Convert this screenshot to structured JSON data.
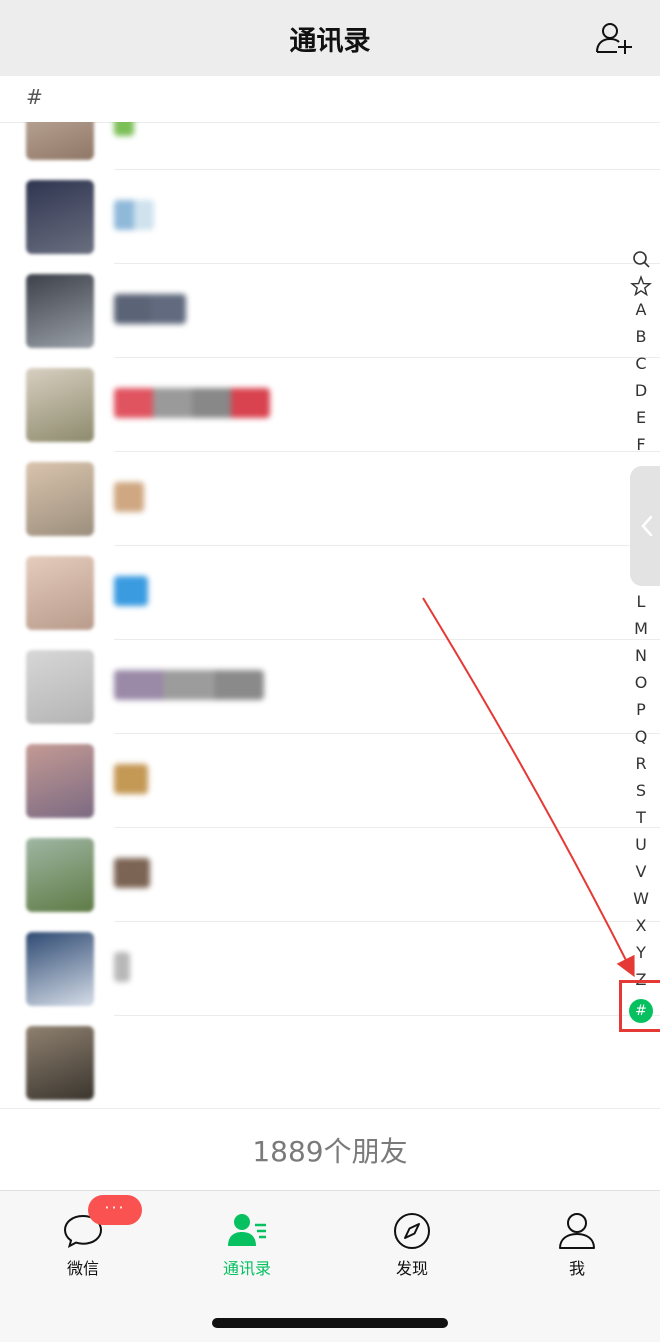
{
  "nav": {
    "title": "通讯录",
    "add_icon": "add-contact-icon"
  },
  "section": {
    "header": "#"
  },
  "contacts": [
    {
      "avatar_colors": [
        "#c9b5a7",
        "#8f7766"
      ],
      "name_colors": [
        "#7bbf57"
      ],
      "name_width": 20
    },
    {
      "avatar_colors": [
        "#2f3550",
        "#6a6f80"
      ],
      "name_colors": [
        "#8fb9d9",
        "#cfe2ee"
      ],
      "name_width": 40
    },
    {
      "avatar_colors": [
        "#3c4049",
        "#9aa0a8"
      ],
      "name_colors": [
        "#5b6377",
        "#616a7e"
      ],
      "name_width": 72
    },
    {
      "avatar_colors": [
        "#d8cfc1",
        "#8d8a6c"
      ],
      "name_colors": [
        "#e05460",
        "#9a9a9a",
        "#888",
        "#d8434f"
      ],
      "name_width": 156
    },
    {
      "avatar_colors": [
        "#d9c4ad",
        "#9c8e7d"
      ],
      "name_colors": [
        "#cfa882"
      ],
      "name_width": 30
    },
    {
      "avatar_colors": [
        "#e5ccbd",
        "#b89b8b"
      ],
      "name_colors": [
        "#3a9be0"
      ],
      "name_width": 34
    },
    {
      "avatar_colors": [
        "#d7d7d7",
        "#b4b4b4"
      ],
      "name_colors": [
        "#9a8aa8",
        "#9c9c9c",
        "#8a8a8a"
      ],
      "name_width": 150
    },
    {
      "avatar_colors": [
        "#c49a94",
        "#7b6a82"
      ],
      "name_colors": [
        "#c49855"
      ],
      "name_width": 34
    },
    {
      "avatar_colors": [
        "#9fb6a3",
        "#5e7b45"
      ],
      "name_colors": [
        "#7c6454"
      ],
      "name_width": 36
    },
    {
      "avatar_colors": [
        "#2e4a72",
        "#d6dde8"
      ],
      "name_colors": [
        "#b8b8b8"
      ],
      "name_width": 16
    },
    {
      "avatar_colors": [
        "#8f8170",
        "#3a352e"
      ],
      "name_colors": [],
      "name_width": 0
    }
  ],
  "footer": {
    "count": "1889个朋友"
  },
  "index": {
    "letters": [
      "A",
      "B",
      "C",
      "D",
      "E",
      "F",
      "L",
      "M",
      "N",
      "O",
      "P",
      "Q",
      "R",
      "S",
      "T",
      "U",
      "V",
      "W",
      "X",
      "Y",
      "Z"
    ],
    "active": "#",
    "search_icon": "search-icon",
    "star_icon": "star-icon",
    "handle_icon": "chevron-left-icon"
  },
  "tabs": [
    {
      "label": "微信",
      "icon": "chat-bubble-icon",
      "active": false
    },
    {
      "label": "通讯录",
      "icon": "contacts-icon",
      "active": true
    },
    {
      "label": "发现",
      "icon": "compass-icon",
      "active": false
    },
    {
      "label": "我",
      "icon": "person-icon",
      "active": false
    }
  ],
  "badge": {
    "text": "···"
  },
  "colors": {
    "accent": "#07c160",
    "badge": "#fa5151",
    "annotation": "#e53935"
  }
}
